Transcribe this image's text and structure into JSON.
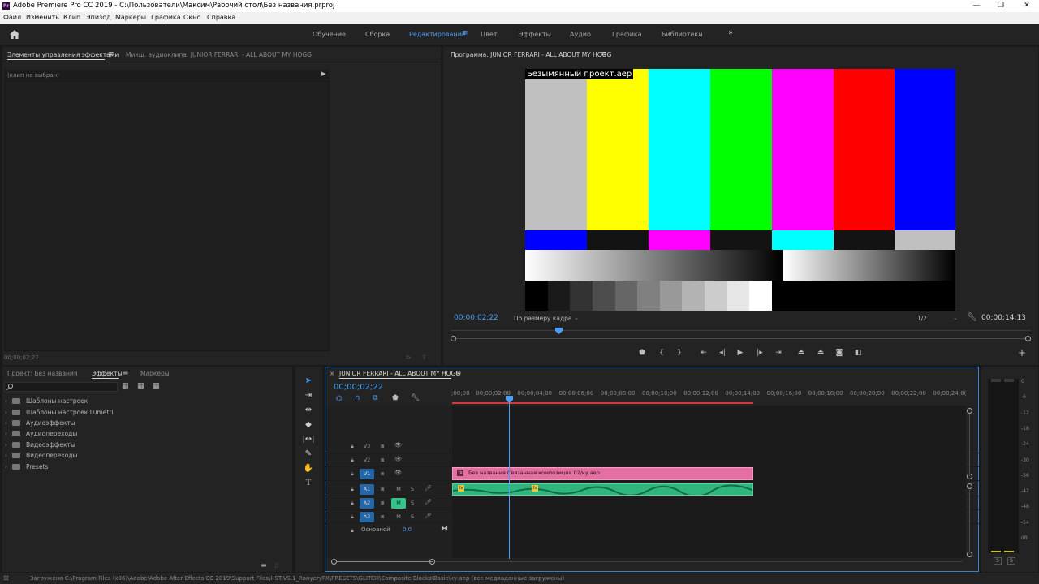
{
  "window": {
    "app_icon": "Pr",
    "title": "Adobe Premiere Pro CC 2019 - C:\\Пользователи\\Максим\\Рабочий стол\\Без названия.prproj",
    "minimize": "—",
    "maximize": "❐",
    "close": "✕"
  },
  "menu": [
    "Файл",
    "Изменить",
    "Клип",
    "Эпизод",
    "Маркеры",
    "Графика",
    "Окно",
    "Справка"
  ],
  "workspaces": {
    "items": [
      "Обучение",
      "Сборка",
      "Редактирование",
      "Цвет",
      "Эффекты",
      "Аудио",
      "Графика",
      "Библиотеки"
    ],
    "active": "Редактирование",
    "more": "»",
    "accent": "#4a9ff2"
  },
  "source_panel": {
    "tab_effect_controls": "Элементы управления эффектами",
    "tab_audio_mixer": "Микш. аудиоклипа: JUNIOR FERRARI - ALL ABOUT MY HOGG",
    "no_clip": "(клип не выбран)",
    "timecode": "00;00;02;22"
  },
  "program_monitor": {
    "tab": "Программа: JUNIOR FERRARI - ALL ABOUT MY HOGG",
    "overlay_label": "Безымянный проект.aep",
    "timecode_current": "00;00;02;22",
    "fit": "По размеру кадра",
    "resolution": "1/2",
    "timecode_duration": "00;00;14;13",
    "playhead_fraction": 0.185
  },
  "project_panel": {
    "tab_project": "Проект: Без названия",
    "tab_effects": "Эффекты",
    "tab_markers": "Маркеры",
    "search_icon": "search-icon",
    "folders": [
      "Шаблоны настроек",
      "Шаблоны настроек Lumetri",
      "Аудиоэффекты",
      "Аудиопереходы",
      "Видеоэффекты",
      "Видеопереходы",
      "Presets"
    ]
  },
  "timeline": {
    "tab": "JUNIOR FERRARI - ALL ABOUT MY HOGG",
    "timecode": "00;00;02;22",
    "ruler": [
      ";00;00",
      "00;00;02;00",
      "00;00;04;00",
      "00;00;06;00",
      "00;00;08;00",
      "00;00;10;00",
      "00;00;12;00",
      "00;00;14;00",
      "00;00;16;00",
      "00;00;18;00",
      "00;00;20;00",
      "00;00;22;00",
      "00;00;24;0("
    ],
    "video_tracks": [
      "V3",
      "V2",
      "V1"
    ],
    "audio_tracks": [
      "A1",
      "A2",
      "A3"
    ],
    "mute": "M",
    "solo": "S",
    "master_label": "Основной",
    "master_value": "0,0",
    "video_clip_fx": "fx",
    "video_clip_label": "Без названия Связанная композиция 02/ку.aep",
    "audio_clip_fx": "fx",
    "clip_video_color": "#e46fa1",
    "clip_audio_color": "#2fb67e"
  },
  "audio_meter": {
    "labels": [
      "0",
      "-6",
      "-12",
      "-18",
      "-24",
      "-30",
      "-36",
      "-42",
      "-48",
      "-54",
      "dB"
    ],
    "solo_left": "S",
    "solo_right": "S"
  },
  "status_bar": "Загружено C:\\Program Files (x86)\\Adobe\\Adobe After Effects CC 2019\\Support Files\\HST.VS.1_RanyeryFX\\PRESETS\\GLITCH\\Composite Blocks\\Basic\\ку.aep (все медиаданные загружены)"
}
